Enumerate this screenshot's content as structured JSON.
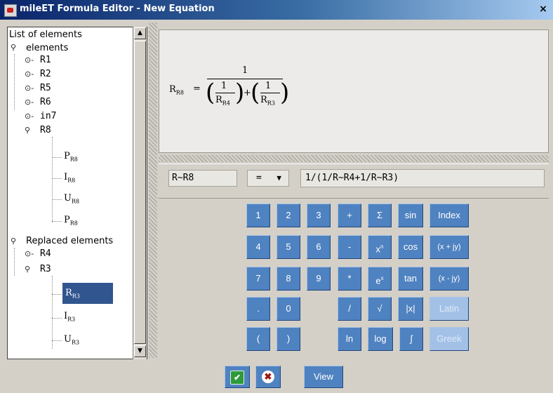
{
  "window": {
    "title": "mileET Formula Editor - New Equation",
    "close_glyph": "×"
  },
  "tree": {
    "heading": "List of elements",
    "elements_label": "elements",
    "elements": [
      "R1",
      "R2",
      "R5",
      "R6",
      "in7"
    ],
    "r8_label": "R8",
    "r8_children": [
      {
        "base": "P",
        "sub": "R8"
      },
      {
        "base": "I",
        "sub": "R8"
      },
      {
        "base": "U",
        "sub": "R8"
      },
      {
        "base": "P",
        "sub": "R8"
      }
    ],
    "replaced_label": "Replaced elements",
    "r4_label": "R4",
    "r3_label": "R3",
    "r3_children": [
      {
        "base": "R",
        "sub": "R3"
      },
      {
        "base": "I",
        "sub": "R3"
      },
      {
        "base": "U",
        "sub": "R3"
      }
    ],
    "selected_index": 0
  },
  "equation": {
    "lhs_base": "R",
    "lhs_sub": "R8",
    "equals": "=",
    "numerator": "1",
    "term1_num": "1",
    "term1_den_base": "R",
    "term1_den_sub": "R4",
    "plus": "+",
    "term2_num": "1",
    "term2_den_base": "R",
    "term2_den_sub": "R3"
  },
  "input": {
    "lhs_value": "R~R8",
    "operator": "=",
    "rhs_value": "1/(1/R~R4+1/R~R3)"
  },
  "keypad": {
    "digits": [
      "1",
      "2",
      "3",
      "4",
      "5",
      "6",
      "7",
      "8",
      "9",
      ".",
      "0",
      "(",
      ")"
    ],
    "ops": [
      "+",
      "-",
      "*",
      "/"
    ],
    "sigma": "Σ",
    "xn_base": "x",
    "xn_sup": "n",
    "ex_base": "e",
    "ex_sup": "x",
    "sqrt": "√",
    "ln": "ln",
    "log": "log",
    "sin": "sin",
    "cos": "cos",
    "tan": "tan",
    "abs": "|x|",
    "integral": "∫",
    "index": "Index",
    "complex_plus": "(x + jy)",
    "complex_minus": "(x - jy)",
    "latin": "Latin",
    "greek": "Greek"
  },
  "bottom": {
    "ok_glyph": "✔",
    "cancel_glyph": "✖",
    "view": "View"
  },
  "colors": {
    "key_blue": "#4f82c0",
    "key_disabled": "#a3c1e7",
    "selection": "#31558e"
  }
}
